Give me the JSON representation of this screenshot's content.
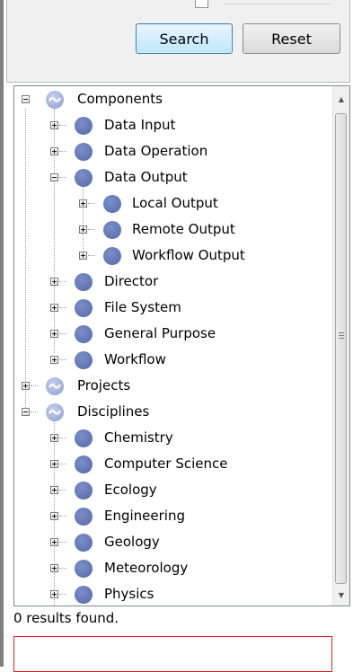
{
  "toolbar": {
    "search_label": "Search",
    "reset_label": "Reset"
  },
  "tree": {
    "components": {
      "label": "Components",
      "children": {
        "data_input": "Data Input",
        "data_operation": "Data Operation",
        "data_output": {
          "label": "Data Output",
          "children": {
            "local_output": "Local Output",
            "remote_output": "Remote Output",
            "workflow_output": "Workflow Output"
          }
        },
        "director": "Director",
        "file_system": "File System",
        "general_purpose": "General Purpose",
        "workflow": "Workflow"
      }
    },
    "projects": {
      "label": "Projects"
    },
    "disciplines": {
      "label": "Disciplines",
      "children": {
        "chemistry": "Chemistry",
        "computer_science": "Computer Science",
        "ecology": "Ecology",
        "engineering": "Engineering",
        "geology": "Geology",
        "meteorology": "Meteorology",
        "physics": "Physics"
      }
    }
  },
  "status": {
    "results_text": "0 results found."
  },
  "icons": {
    "category": "category-icon",
    "node": "component-node-icon",
    "collapse": "collapse-icon",
    "expand": "expand-icon"
  }
}
